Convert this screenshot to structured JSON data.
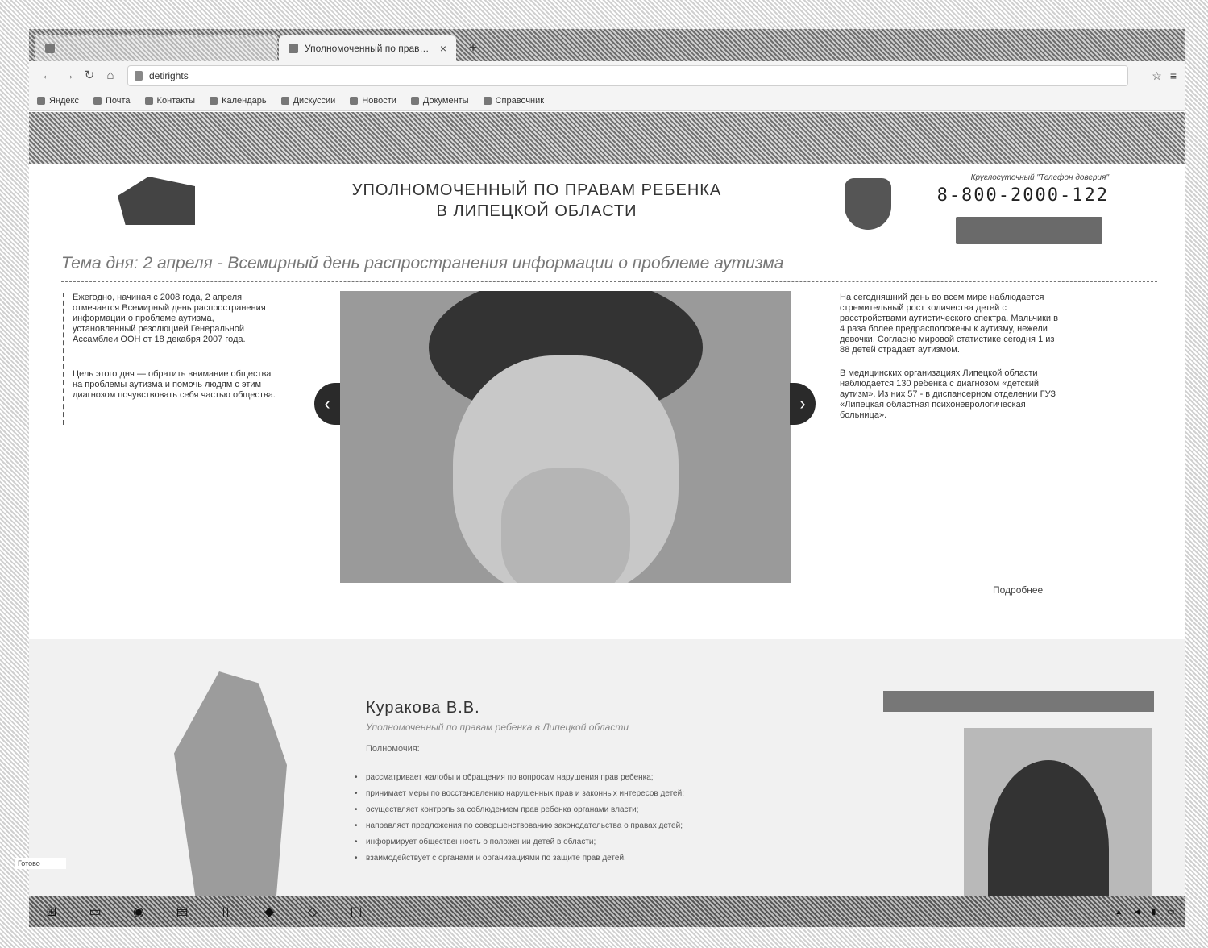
{
  "browser": {
    "tabs": [
      {
        "title": "",
        "active": false
      },
      {
        "title": "Уполномоченный по правам…",
        "active": true
      }
    ],
    "address": "detirights",
    "bookmarks": [
      {
        "label": "Яндекс",
        "icon": "yandex-icon"
      },
      {
        "label": "Почта",
        "icon": "mail-icon"
      },
      {
        "label": "Контакты",
        "icon": "contacts-icon"
      },
      {
        "label": "Календарь",
        "icon": "calendar-icon"
      },
      {
        "label": "Дискуссии",
        "icon": "discussion-icon"
      },
      {
        "label": "Новости",
        "icon": "news-icon"
      },
      {
        "label": "Документы",
        "icon": "docs-icon"
      },
      {
        "label": "Справочник",
        "icon": "reference-icon"
      }
    ]
  },
  "header": {
    "title_line1": "УПОЛНОМОЧЕННЫЙ ПО ПРАВАМ РЕБЕНКА",
    "title_line2": "В ЛИПЕЦКОЙ ОБЛАСТИ",
    "hotline_label": "Круглосуточный \"Телефон доверия\"",
    "hotline_number": "8-800-2000-122"
  },
  "topic": "Тема дня: 2 апреля - Всемирный день распространения информации о проблеме аутизма",
  "left_column": [
    "Ежегодно, начиная с 2008 года, 2 апреля отмечается Всемирный день распространения информации о проблеме аутизма, установленный резолюцией Генеральной Ассамблеи ООН от 18 декабря 2007 года.",
    "Цель этого дня — обратить внимание общества на проблемы аутизма и помочь людям с этим диагнозом почувствовать себя частью общества."
  ],
  "right_column": [
    "На сегодняшний день во всем мире наблюдается стремительный рост количества детей с расстройствами аутистического спектра. Мальчики в 4 раза более предрасположены к аутизму, нежели девочки. Согласно мировой статистике сегодня 1 из 88 детей страдает аутизмом.",
    "В медицинских организациях Липецкой области наблюдается 130 ребенка с диагнозом «детский аутизм». Из них 57 - в диспансерном отделении ГУЗ «Липецкая областная психоневрологическая больница»."
  ],
  "more_link": "Подробнее",
  "ombudsman": {
    "name": "Куракова В.В.",
    "role": "Уполномоченный по правам ребенка в Липецкой области",
    "resp_title": "Полномочия:",
    "duties": [
      "рассматривает жалобы и обращения по вопросам нарушения прав ребенка;",
      "принимает меры по восстановлению нарушенных прав и законных интересов детей;",
      "осуществляет контроль за соблюдением прав ребенка органами власти;",
      "направляет предложения по совершенствованию законодательства о правах детей;",
      "информирует общественность о положении детей в области;",
      "взаимодействует с органами и организациями по защите прав детей."
    ]
  },
  "status_url": "Готово"
}
